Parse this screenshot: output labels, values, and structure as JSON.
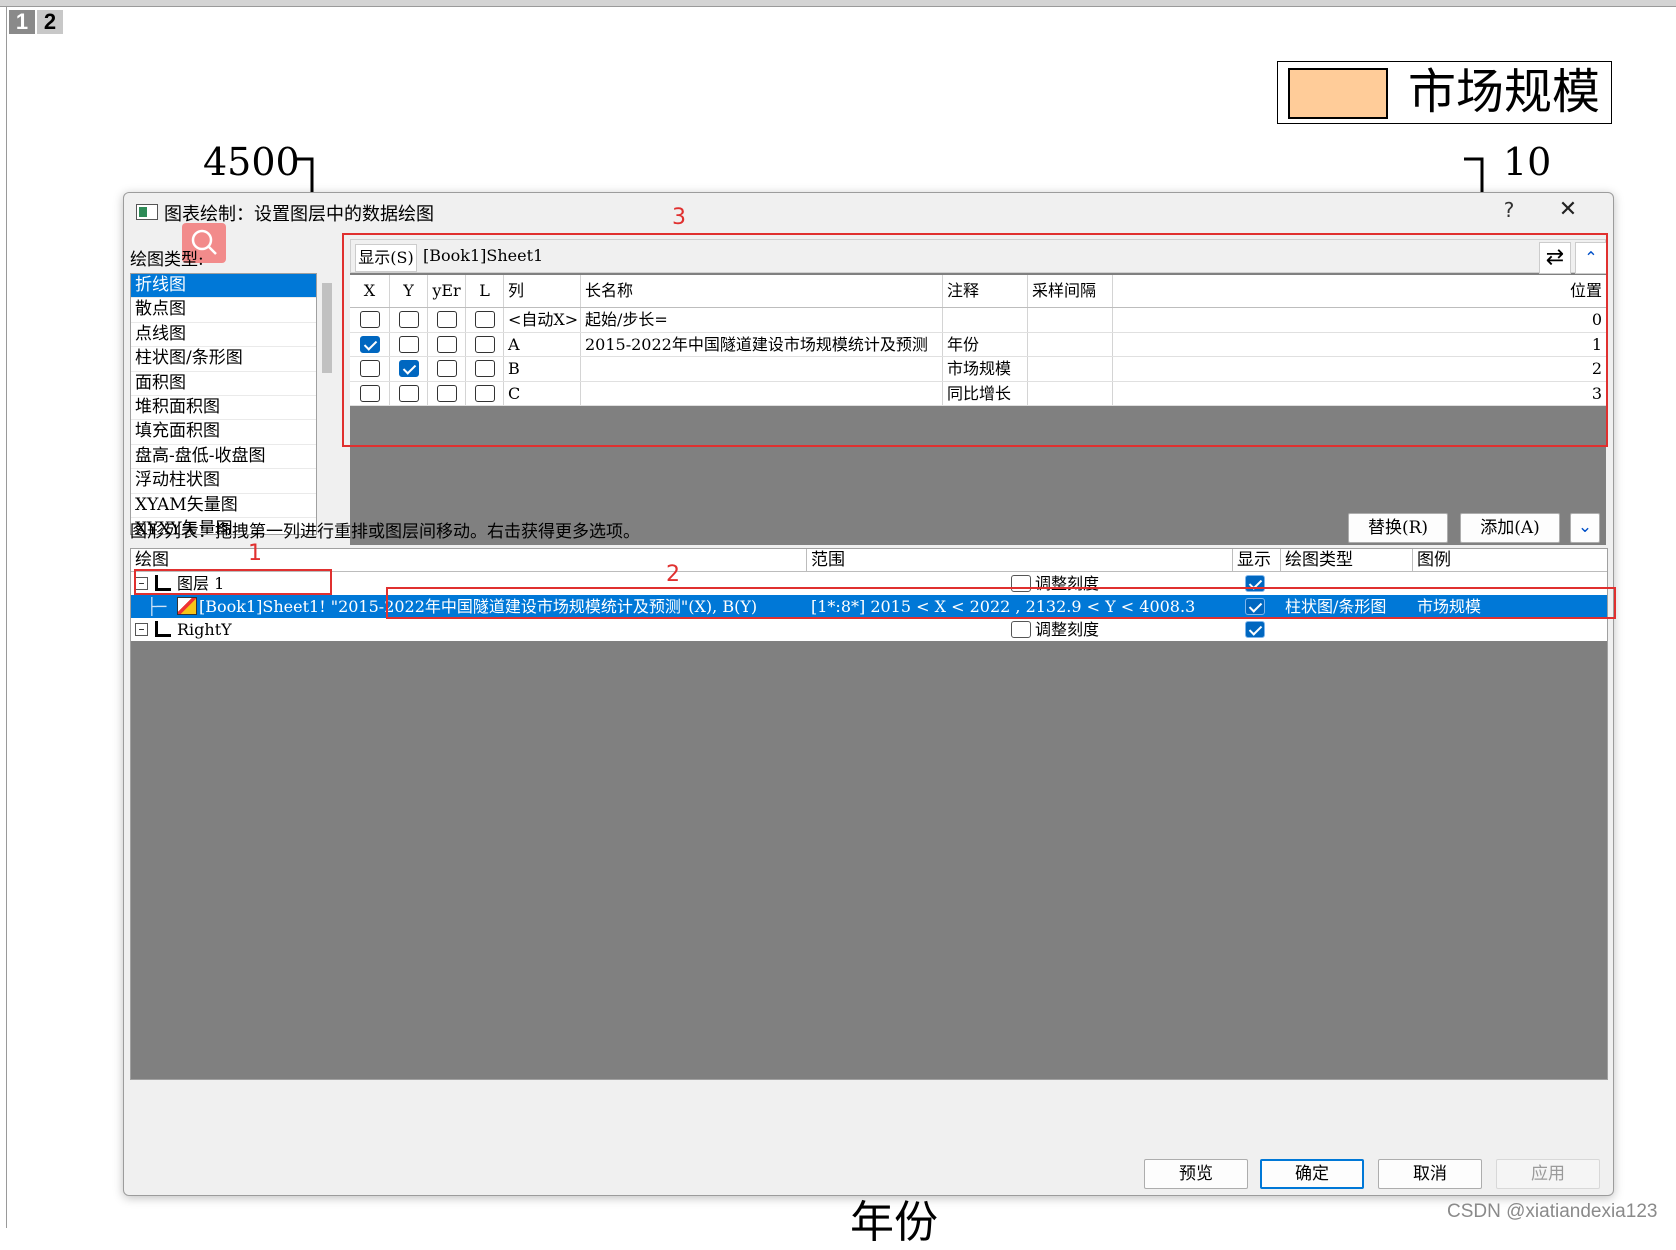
{
  "page_tabs": [
    "1",
    "2"
  ],
  "legend": {
    "label": "市场规模",
    "swatch_color": "#ffcc99"
  },
  "axis": {
    "left_top": "4500",
    "right_top": "10",
    "bottom_title": "年份"
  },
  "dialog": {
    "title": "图表绘制：设置图层中的数据绘图",
    "help": "?",
    "close": "✕",
    "plot_type_label": "绘图类型:",
    "plot_types": [
      "折线图",
      "散点图",
      "点线图",
      "柱状图/条形图",
      "面积图",
      "堆积面积图",
      "填充面积图",
      "盘高-盘低-收盘图",
      "浮动柱状图",
      "XYAM矢量图",
      "XYXY矢量图"
    ],
    "selected_plot_type": "折线图",
    "show_button": "显示(S)",
    "sheet": "[Book1]Sheet1",
    "swap_icon": "⇄",
    "collapse_icon": "⌃",
    "grid_headers": [
      "X",
      "Y",
      "yEr",
      "L",
      "列",
      "长名称",
      "注释",
      "采样间隔",
      "位置"
    ],
    "grid_rows": [
      {
        "x": false,
        "y": false,
        "yer": false,
        "l": false,
        "col": "<自动X>",
        "long_name": "起始/步长=",
        "comment": "",
        "interval": "",
        "position": "0"
      },
      {
        "x": true,
        "y": false,
        "yer": false,
        "l": false,
        "col": "A",
        "long_name": "2015-2022年中国隧道建设市场规模统计及预测",
        "comment": "年份",
        "interval": "",
        "position": "1"
      },
      {
        "x": false,
        "y": true,
        "yer": false,
        "l": false,
        "col": "B",
        "long_name": "",
        "comment": "市场规模",
        "interval": "",
        "position": "2"
      },
      {
        "x": false,
        "y": false,
        "yer": false,
        "l": false,
        "col": "C",
        "long_name": "",
        "comment": "同比增长",
        "interval": "",
        "position": "3"
      }
    ],
    "hint": "图形列表：拖拽第一列进行重排或图层间移动。右击获得更多选项。",
    "replace_button": "替换(R)",
    "add_button": "添加(A)",
    "expand_icon": "⌄",
    "list_headers": [
      "绘图",
      "范围",
      "显示",
      "绘图类型",
      "图例"
    ],
    "list_rows": [
      {
        "name": "图层 1",
        "rescale": "调整刻度",
        "show": true
      },
      {
        "name": "[Book1]Sheet1! \"2015-2022年中国隧道建设市场规模统计及预测\"(X), B(Y)",
        "range": "[1*:8*]  2015 < X < 2022 , 2132.9 < Y < 4008.3",
        "show": true,
        "plot_type": "柱状图/条形图",
        "legend": "市场规模"
      },
      {
        "name": "RightY",
        "rescale": "调整刻度",
        "show": true
      }
    ],
    "buttons": {
      "preview": "预览",
      "ok": "确定",
      "cancel": "取消",
      "apply": "应用"
    }
  },
  "annotations": {
    "n1": "1",
    "n2": "2",
    "n3": "3"
  },
  "watermark": "CSDN @xiatiandexia123"
}
